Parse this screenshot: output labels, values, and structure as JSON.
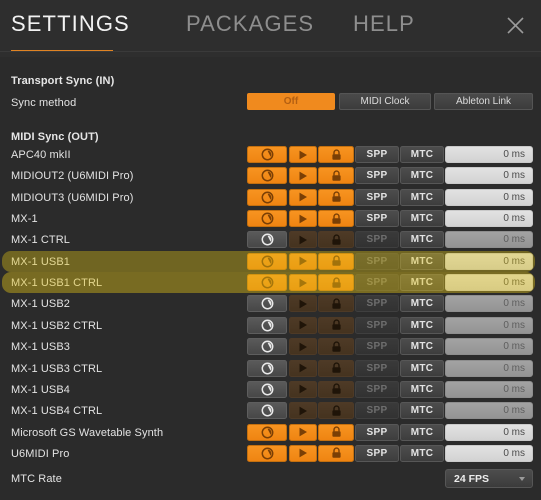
{
  "window": {
    "tabs": [
      {
        "label": "SETTINGS",
        "active": true
      },
      {
        "label": "PACKAGES",
        "active": false
      },
      {
        "label": "HELP",
        "active": false
      }
    ],
    "close_icon": "close-icon",
    "accent_color": "#e08424",
    "background_color": "#2b2b2b"
  },
  "transport_sync": {
    "section_title": "Transport Sync (IN)",
    "sync_method_label": "Sync method",
    "options": [
      {
        "label": "Off",
        "selected": true
      },
      {
        "label": "MIDI Clock",
        "selected": false
      },
      {
        "label": "Ableton Link",
        "selected": false
      }
    ]
  },
  "midi_sync": {
    "section_title": "MIDI Sync (OUT)",
    "column_icons": [
      "clock-icon",
      "play-icon",
      "lock-icon"
    ],
    "column_buttons": [
      "SPP",
      "MTC"
    ],
    "delay_unit": "ms",
    "rows": [
      {
        "name": "APC40 mkII",
        "clock": "on",
        "play": "on",
        "lock": "on",
        "spp": "norm",
        "mtc": "norm",
        "delay": "0 ms",
        "delay_style": "light",
        "highlighted": false
      },
      {
        "name": "MIDIOUT2 (U6MIDI Pro)",
        "clock": "on",
        "play": "on",
        "lock": "on",
        "spp": "norm",
        "mtc": "norm",
        "delay": "0 ms",
        "delay_style": "light",
        "highlighted": false
      },
      {
        "name": "MIDIOUT3 (U6MIDI Pro)",
        "clock": "on",
        "play": "on",
        "lock": "on",
        "spp": "norm",
        "mtc": "norm",
        "delay": "0 ms",
        "delay_style": "light",
        "highlighted": false
      },
      {
        "name": "MX-1",
        "clock": "on",
        "play": "on",
        "lock": "on",
        "spp": "norm",
        "mtc": "norm",
        "delay": "0 ms",
        "delay_style": "light",
        "highlighted": false
      },
      {
        "name": "MX-1 CTRL",
        "clock": "gray",
        "play": "dk",
        "lock": "dk",
        "spp": "dimtxt",
        "mtc": "norm",
        "delay": "0 ms",
        "delay_style": "midgray",
        "highlighted": false
      },
      {
        "name": "MX-1 USB1",
        "clock": "on",
        "play": "on",
        "lock": "on",
        "spp": "dimtxt",
        "mtc": "norm",
        "delay": "0 ms",
        "delay_style": "light",
        "highlighted": true
      },
      {
        "name": "MX-1 USB1 CTRL",
        "clock": "on",
        "play": "on",
        "lock": "on",
        "spp": "dimtxt",
        "mtc": "norm",
        "delay": "0 ms",
        "delay_style": "light",
        "highlighted": true
      },
      {
        "name": "MX-1 USB2",
        "clock": "gray",
        "play": "dk",
        "lock": "dk",
        "spp": "dimtxt",
        "mtc": "norm",
        "delay": "0 ms",
        "delay_style": "midgray",
        "highlighted": false
      },
      {
        "name": "MX-1 USB2 CTRL",
        "clock": "gray",
        "play": "dk",
        "lock": "dk",
        "spp": "dimtxt",
        "mtc": "norm",
        "delay": "0 ms",
        "delay_style": "midgray",
        "highlighted": false
      },
      {
        "name": "MX-1 USB3",
        "clock": "gray",
        "play": "dk",
        "lock": "dk",
        "spp": "dimtxt",
        "mtc": "norm",
        "delay": "0 ms",
        "delay_style": "midgray",
        "highlighted": false
      },
      {
        "name": "MX-1 USB3 CTRL",
        "clock": "gray",
        "play": "dk",
        "lock": "dk",
        "spp": "dimtxt",
        "mtc": "norm",
        "delay": "0 ms",
        "delay_style": "midgray",
        "highlighted": false
      },
      {
        "name": "MX-1 USB4",
        "clock": "gray",
        "play": "dk",
        "lock": "dk",
        "spp": "dimtxt",
        "mtc": "norm",
        "delay": "0 ms",
        "delay_style": "midgray",
        "highlighted": false
      },
      {
        "name": "MX-1 USB4 CTRL",
        "clock": "gray",
        "play": "dk",
        "lock": "dk",
        "spp": "dimtxt",
        "mtc": "norm",
        "delay": "0 ms",
        "delay_style": "midgray",
        "highlighted": false
      },
      {
        "name": "Microsoft GS Wavetable Synth",
        "clock": "on",
        "play": "on",
        "lock": "on",
        "spp": "norm",
        "mtc": "norm",
        "delay": "0 ms",
        "delay_style": "light",
        "highlighted": false
      },
      {
        "name": "U6MIDI Pro",
        "clock": "on",
        "play": "on",
        "lock": "on",
        "spp": "norm",
        "mtc": "norm",
        "delay": "0 ms",
        "delay_style": "light",
        "highlighted": false
      }
    ]
  },
  "mtc_rate": {
    "label": "MTC Rate",
    "value": "24 FPS"
  }
}
